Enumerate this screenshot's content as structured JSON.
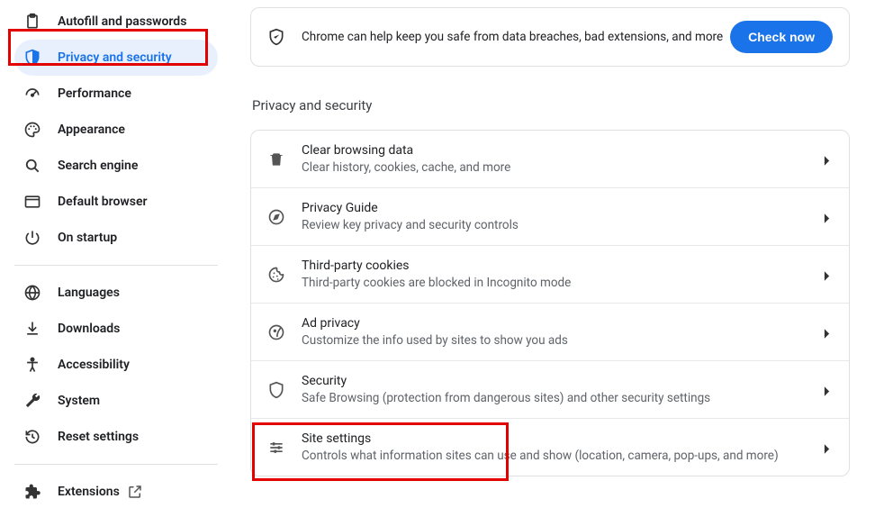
{
  "sidebar": {
    "items": [
      {
        "label": "Autofill and passwords"
      },
      {
        "label": "Privacy and security"
      },
      {
        "label": "Performance"
      },
      {
        "label": "Appearance"
      },
      {
        "label": "Search engine"
      },
      {
        "label": "Default browser"
      },
      {
        "label": "On startup"
      }
    ],
    "group2": [
      {
        "label": "Languages"
      },
      {
        "label": "Downloads"
      },
      {
        "label": "Accessibility"
      },
      {
        "label": "System"
      },
      {
        "label": "Reset settings"
      }
    ],
    "group3": [
      {
        "label": "Extensions"
      }
    ]
  },
  "banner": {
    "text": "Chrome can help keep you safe from data breaches, bad extensions, and more",
    "button": "Check now"
  },
  "section": {
    "title": "Privacy and security",
    "rows": [
      {
        "title": "Clear browsing data",
        "sub": "Clear history, cookies, cache, and more"
      },
      {
        "title": "Privacy Guide",
        "sub": "Review key privacy and security controls"
      },
      {
        "title": "Third-party cookies",
        "sub": "Third-party cookies are blocked in Incognito mode"
      },
      {
        "title": "Ad privacy",
        "sub": "Customize the info used by sites to show you ads"
      },
      {
        "title": "Security",
        "sub": "Safe Browsing (protection from dangerous sites) and other security settings"
      },
      {
        "title": "Site settings",
        "sub": "Controls what information sites can use and show (location, camera, pop-ups, and more)"
      }
    ]
  }
}
